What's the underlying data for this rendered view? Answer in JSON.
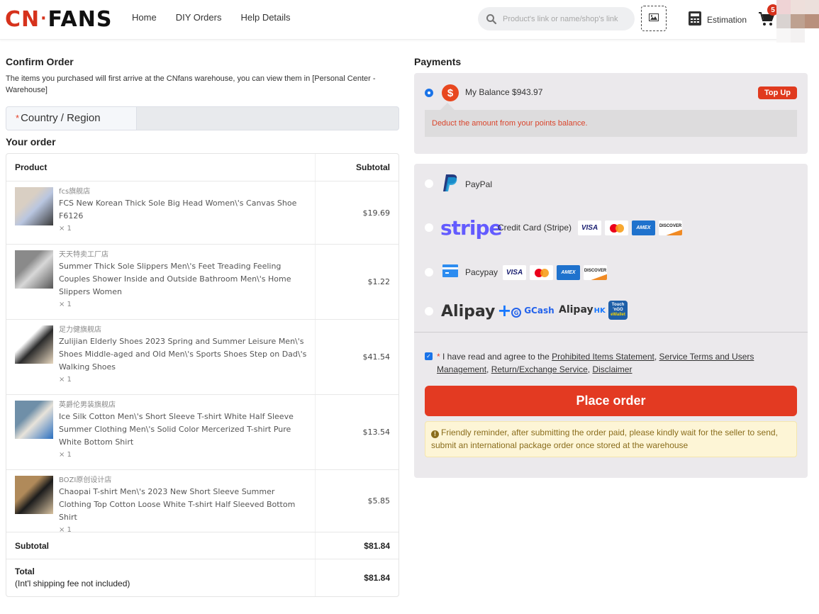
{
  "header": {
    "logo": {
      "cn": "CN",
      "dot": "·",
      "fans": "FANS"
    },
    "nav": [
      {
        "label": "Home"
      },
      {
        "label": "DIY Orders"
      },
      {
        "label": "Help Details"
      }
    ],
    "search": {
      "placeholder": "Product's link or name/shop's link",
      "icon": "search-icon"
    },
    "image_search_icon": "image-icon",
    "estimation_label": "Estimation",
    "cart_count": "5"
  },
  "confirm": {
    "title": "Confirm Order",
    "description": "The items you purchased will first arrive at the CNfans warehouse, you can view them in [Personal Center - Warehouse]",
    "country_required_mark": "*",
    "country_label": "Country / Region",
    "country_value": ""
  },
  "order": {
    "title": "Your order",
    "columns": {
      "product": "Product",
      "subtotal": "Subtotal"
    },
    "items": [
      {
        "shop": "fcs旗舰店",
        "name": "FCS New Korean Thick Sole Big Head Women\\'s Canvas Shoe F6126",
        "qty": "× 1",
        "price": "$19.69",
        "thumb_colors": [
          "#d9cfc3",
          "#b9c6e0",
          "#3a3a3a"
        ]
      },
      {
        "shop": "天天特卖工厂店",
        "name": "Summer Thick Sole Slippers Men\\'s Feet Treading Feeling Couples Shower Inside and Outside Bathroom Men\\'s Home Slippers Women",
        "qty": "× 1",
        "price": "$1.22",
        "thumb_colors": [
          "#8a8a8a",
          "#d8d8d8",
          "#555555"
        ]
      },
      {
        "shop": "足力健旗舰店",
        "name": "Zulijian Elderly Shoes 2023 Spring and Summer Leisure Men\\'s Shoes Middle-aged and Old Men\\'s Sports Shoes Step on Dad\\'s Walking Shoes",
        "qty": "× 1",
        "price": "$41.54",
        "thumb_colors": [
          "#ffffff",
          "#2b2b2b",
          "#e8d8c0"
        ]
      },
      {
        "shop": "英爵伦男装旗舰店",
        "name": "Ice Silk Cotton Men\\'s Short Sleeve T-shirt White Half Sleeve Summer Clothing Men\\'s Solid Color Mercerized T-shirt Pure White Bottom Shirt",
        "qty": "× 1",
        "price": "$13.54",
        "thumb_colors": [
          "#6f8fa8",
          "#e8e3da",
          "#2a6fc0"
        ]
      },
      {
        "shop": "BOZI原创设计店",
        "name": "Chaopai T-shirt Men\\'s 2023 New Short Sleeve Summer Clothing Top Cotton Loose White T-shirt Half Sleeved Bottom Shirt",
        "qty": "× 1",
        "price": "$5.85",
        "thumb_colors": [
          "#b08a5a",
          "#1c1c1c",
          "#d8c2a0"
        ]
      }
    ],
    "subtotal_label": "Subtotal",
    "subtotal_value": "$81.84",
    "total_label": "Total",
    "total_note": "(Int'l shipping fee not included)",
    "total_value": "$81.84"
  },
  "payments": {
    "title": "Payments",
    "balance": {
      "label": "My Balance $943.97",
      "icon": "dollar-icon",
      "topup_label": "Top Up",
      "note": "Deduct the amount from your points balance.",
      "selected": true
    },
    "methods": [
      {
        "id": "paypal",
        "label": "PayPal",
        "selected": false
      },
      {
        "id": "stripe",
        "logo": "stripe",
        "label": "Credit Card (Stripe)",
        "cards": [
          "VISA",
          "mastercard",
          "AMEX",
          "DISCOVER"
        ],
        "selected": false
      },
      {
        "id": "pacypay",
        "label": "Pacypay",
        "cards": [
          "VISA",
          "mastercard",
          "AMEX",
          "DISCOVER"
        ],
        "selected": false
      },
      {
        "id": "alipay",
        "logo": "Alipay",
        "extras": [
          "GCash",
          "Alipay",
          "HK",
          "Touch 'n Go eWallet"
        ],
        "selected": false
      }
    ],
    "agree": {
      "checked": true,
      "required_mark": "*",
      "prefix": " I have read and agree to the ",
      "links": [
        "Prohibited Items Statement",
        "Service Terms and Users Management",
        "Return/Exchange Service",
        "Disclaimer"
      ],
      "separator": ", "
    },
    "place_order_label": "Place order",
    "reminder": "Friendly reminder, after submitting the order paid, please kindly wait for the seller to send, submit an international package order once stored at the warehouse"
  },
  "colors": {
    "brand": "#d6321c",
    "primary_button": "#e33a22",
    "selected_radio": "#1a73e8",
    "stripe": "#635bff"
  }
}
